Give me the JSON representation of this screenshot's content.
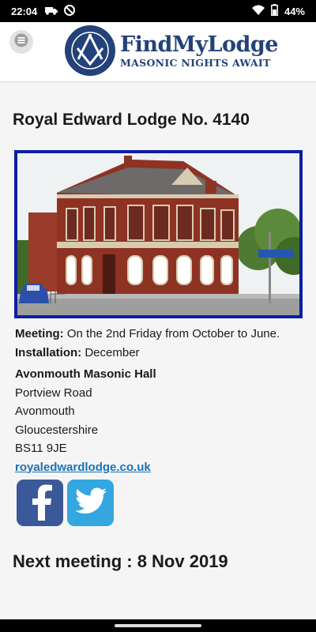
{
  "status_bar": {
    "time": "22:04",
    "battery": "44%",
    "icons": [
      "truck-icon",
      "do-not-disturb-icon",
      "wifi-icon",
      "battery-icon"
    ]
  },
  "header": {
    "menu_icon": "menu-icon",
    "logo_title": "FindMyLodge",
    "logo_tagline": "MASONIC NIGHTS AWAIT",
    "brand_color": "#23427a"
  },
  "lodge": {
    "name": "Royal Edward Lodge No. 4140",
    "photo_description": "",
    "meeting_label": "Meeting:",
    "meeting_value": "On the 2nd Friday from October to June.",
    "installation_label": "Installation:",
    "installation_value": "December",
    "hall_name": "Avonmouth Masonic Hall",
    "address": [
      "Portview Road",
      "Avonmouth",
      "Gloucestershire",
      "BS11 9JE"
    ],
    "website": "royaledwardlodge.co.uk"
  },
  "socials": {
    "facebook_icon": "facebook-icon",
    "twitter_icon": "twitter-icon",
    "facebook_color": "#3b5998",
    "twitter_color": "#34a6e0"
  },
  "next_meeting": "Next meeting : 8 Nov 2019"
}
